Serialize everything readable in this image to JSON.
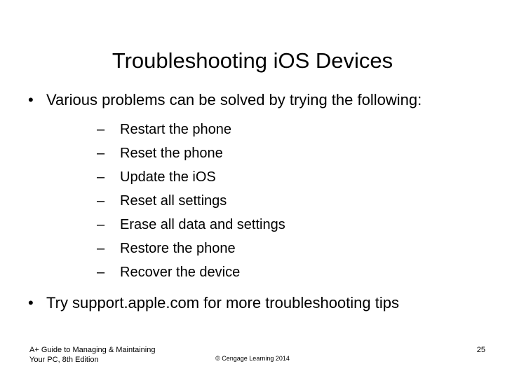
{
  "slide": {
    "title": "Troubleshooting iOS Devices",
    "background_color": "#ffffff",
    "text_color": "#000000",
    "bullet_marker_level1": "•",
    "bullet_marker_level2": "–",
    "bullets": [
      {
        "text": "Various problems can be solved by trying the following:",
        "sub_bullets": [
          "Restart the phone",
          "Reset the phone",
          "Update the iOS",
          "Reset all settings",
          "Erase all data and settings",
          "Restore the phone",
          "Recover the device"
        ]
      },
      {
        "text": "Try support.apple.com for more troubleshooting tips",
        "sub_bullets": []
      }
    ]
  },
  "footer": {
    "left_line1": "A+ Guide to Managing & Maintaining",
    "left_line2": "Your PC, 8th Edition",
    "copyright": "© Cengage Learning 2014",
    "page_number": "25"
  }
}
